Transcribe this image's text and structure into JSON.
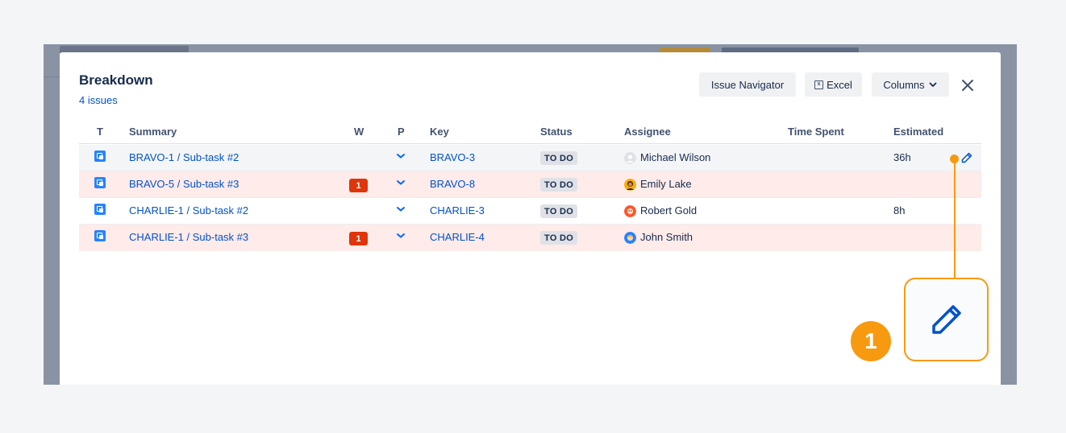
{
  "modal": {
    "title": "Breakdown",
    "subtitle": "4 issues",
    "buttons": {
      "issue_navigator": "Issue Navigator",
      "excel": "Excel",
      "columns": "Columns"
    }
  },
  "table": {
    "columns": [
      "T",
      "Summary",
      "W",
      "P",
      "Key",
      "Status",
      "Assignee",
      "Time Spent",
      "Estimated"
    ],
    "rows": [
      {
        "summary": "BRAVO-1 /  Sub-task #2",
        "warning": "",
        "key": "BRAVO-3",
        "status": "TO DO",
        "assignee": "Michael Wilson",
        "time_spent": "",
        "estimated": "36h"
      },
      {
        "summary": "BRAVO-5 /  Sub-task #3",
        "warning": "1",
        "key": "BRAVO-8",
        "status": "TO DO",
        "assignee": "Emily Lake",
        "time_spent": "",
        "estimated": ""
      },
      {
        "summary": "CHARLIE-1 /  Sub-task #2",
        "warning": "",
        "key": "CHARLIE-3",
        "status": "TO DO",
        "assignee": "Robert Gold",
        "time_spent": "",
        "estimated": "8h"
      },
      {
        "summary": "CHARLIE-1 /  Sub-task #3",
        "warning": "1",
        "key": "CHARLIE-4",
        "status": "TO DO",
        "assignee": "John Smith",
        "time_spent": "",
        "estimated": ""
      }
    ]
  },
  "callout": {
    "number": "1"
  },
  "icons": {
    "type": "subtask-icon",
    "priority": "priority-low-icon",
    "edit": "pencil-icon",
    "close": "close-icon",
    "columns_chevron": "chevron-down-icon",
    "excel": "excel-icon"
  },
  "colors": {
    "link": "#0052cc",
    "warning_badge": "#de350b",
    "row_highlight": "#ffebe9",
    "callout": "#f79a10"
  }
}
